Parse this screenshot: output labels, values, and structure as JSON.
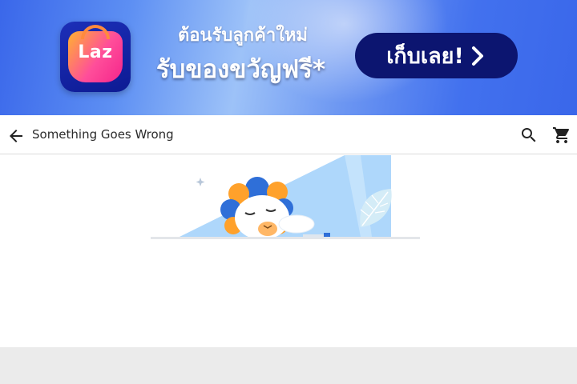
{
  "banner": {
    "brand": "Laz",
    "welcome_text": "ต้อนรับลูกค้าใหม่",
    "offer_text": "รับของขวัญฟรี*",
    "cta_label": "เก็บเลย!",
    "cta_icon": "chevron-right-icon",
    "colors": {
      "background": "#3a67ea",
      "cta_background": "#0c1570",
      "logo_tile": "#1c2fb8",
      "logo_gradient_start": "#ffb230",
      "logo_gradient_end": "#f5258b"
    }
  },
  "appbar": {
    "title": "Something Goes Wrong",
    "back_icon": "arrow-left-icon",
    "search_icon": "search-icon",
    "cart_icon": "cart-icon"
  },
  "illustration": {
    "subject": "sleeping-lion-mascot"
  },
  "error": {
    "heading": "",
    "message": "",
    "note": "",
    "retry_label": ""
  }
}
